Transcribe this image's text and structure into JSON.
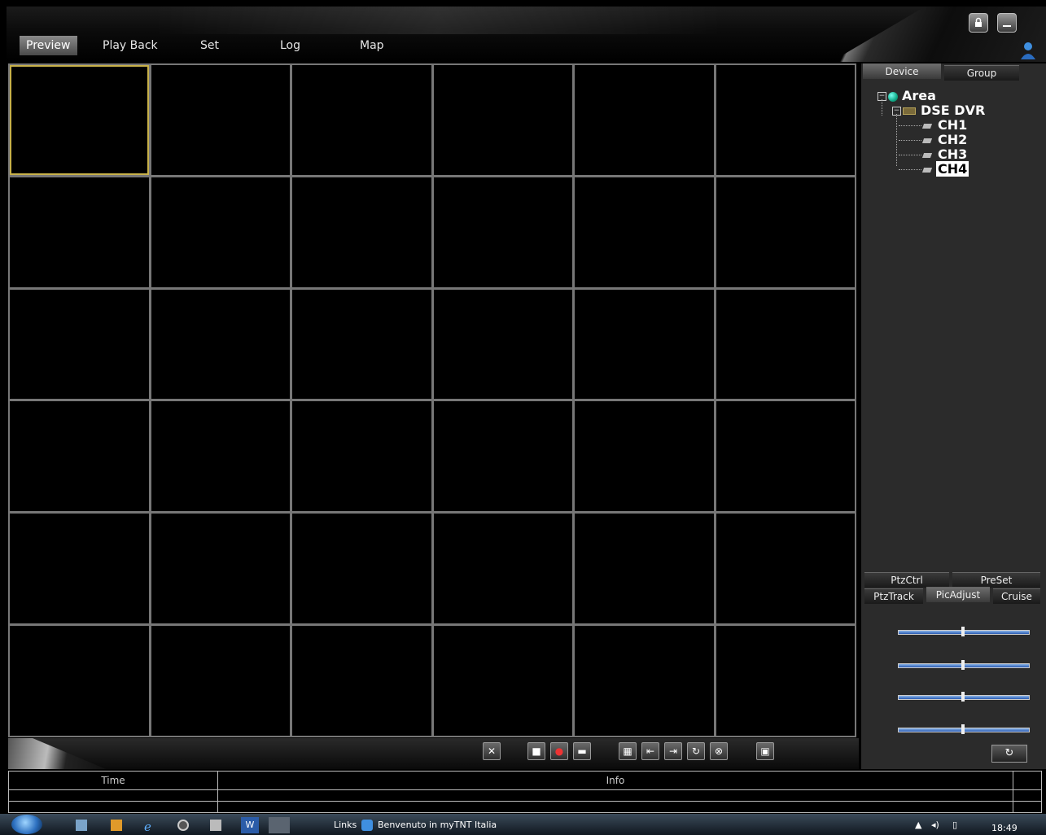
{
  "menu": {
    "items": [
      "Preview",
      "Play Back",
      "Set",
      "Log",
      "Map"
    ],
    "active": "Preview"
  },
  "window_buttons": {
    "lock": "lock-icon",
    "minimize": "minimize-icon"
  },
  "side_tabs": {
    "device": "Device",
    "group": "Group"
  },
  "tree": {
    "root": "Area",
    "dvr": "DSE DVR",
    "channels": [
      "CH1",
      "CH2",
      "CH3",
      "CH4"
    ],
    "selected": "CH4"
  },
  "ptz_tabs": {
    "row1": [
      "PtzCtrl",
      "PreSet"
    ],
    "row2": [
      "PtzTrack",
      "PicAdjust",
      "Cruise"
    ],
    "active": "PicAdjust"
  },
  "pic_adjust": {
    "levels": [
      0.5,
      0.5,
      0.5,
      0.5
    ]
  },
  "video_grid": {
    "rows": 6,
    "cols": 6,
    "selected_cell": 0
  },
  "log_table": {
    "columns": [
      "Time",
      "Info"
    ]
  },
  "taskbar": {
    "links_label": "Links",
    "open_item": "Benvenuto in myTNT Italia",
    "clock": "18:49"
  },
  "colors": {
    "selection_border": "#c8b14a",
    "slider_track": "#2a5cb4"
  }
}
